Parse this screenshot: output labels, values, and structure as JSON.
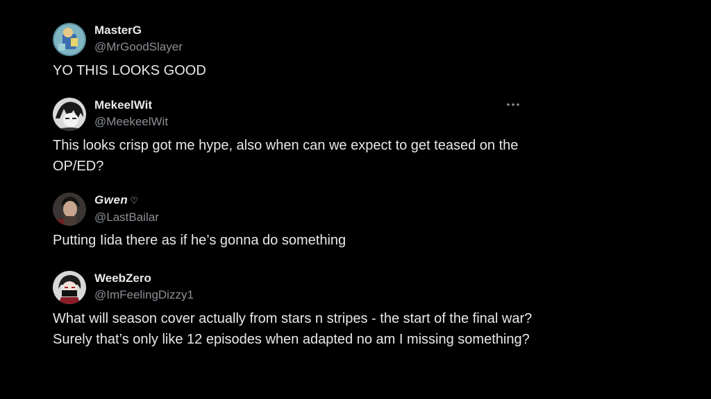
{
  "posts": [
    {
      "display_name": "MasterG",
      "handle": "@MrGoodSlayer",
      "text": "YO THIS LOOKS GOOD",
      "avatar_icon": "masterg-avatar"
    },
    {
      "display_name": "MekeelWit",
      "handle": "@MeekeelWit",
      "text": "This looks crisp got me hype, also when can we expect to get teased on the OP/ED?",
      "avatar_icon": "mekeelwit-avatar",
      "more_icon": "more-horizontal-icon"
    },
    {
      "display_name": "Gwen",
      "name_emoji": "♡",
      "handle": "@LastBailar",
      "text": "Putting Iida there as if he’s gonna do something",
      "avatar_icon": "gwen-avatar"
    },
    {
      "display_name": "WeebZero",
      "handle": "@ImFeelingDizzy1",
      "text": "What will season cover actually from stars n stripes - the start of the final war? Surely that’s only like 12 episodes when adapted no am I missing something?",
      "avatar_icon": "weebzero-avatar"
    }
  ],
  "colors": {
    "background": "#000000",
    "text": "#e7e9ea",
    "secondary_text": "#8b9096"
  }
}
